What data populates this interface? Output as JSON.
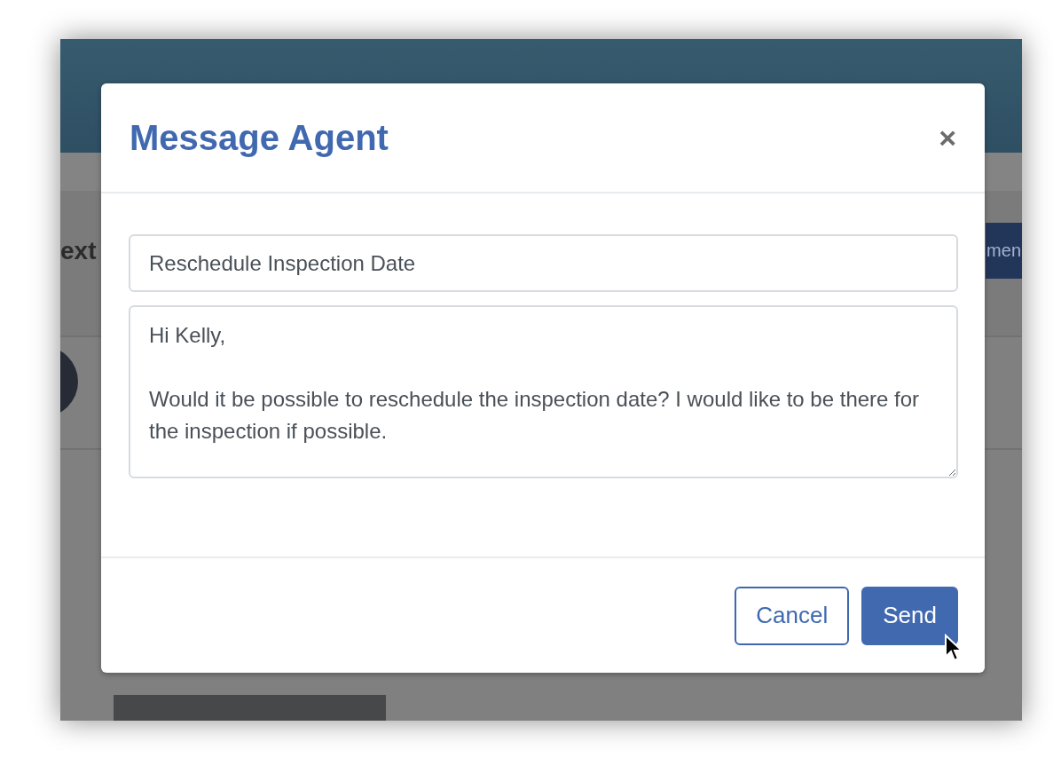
{
  "background": {
    "heading": "ext",
    "button": "men"
  },
  "modal": {
    "title": "Message Agent",
    "close": "×",
    "subject": "Reschedule Inspection Date",
    "message": "Hi Kelly,\n\nWould it be possible to reschedule the inspection date? I would like to be there for the inspection if possible.",
    "buttons": [
      {
        "label": "Cancel",
        "kind": "secondary"
      },
      {
        "label": "Send",
        "kind": "primary"
      }
    ]
  }
}
